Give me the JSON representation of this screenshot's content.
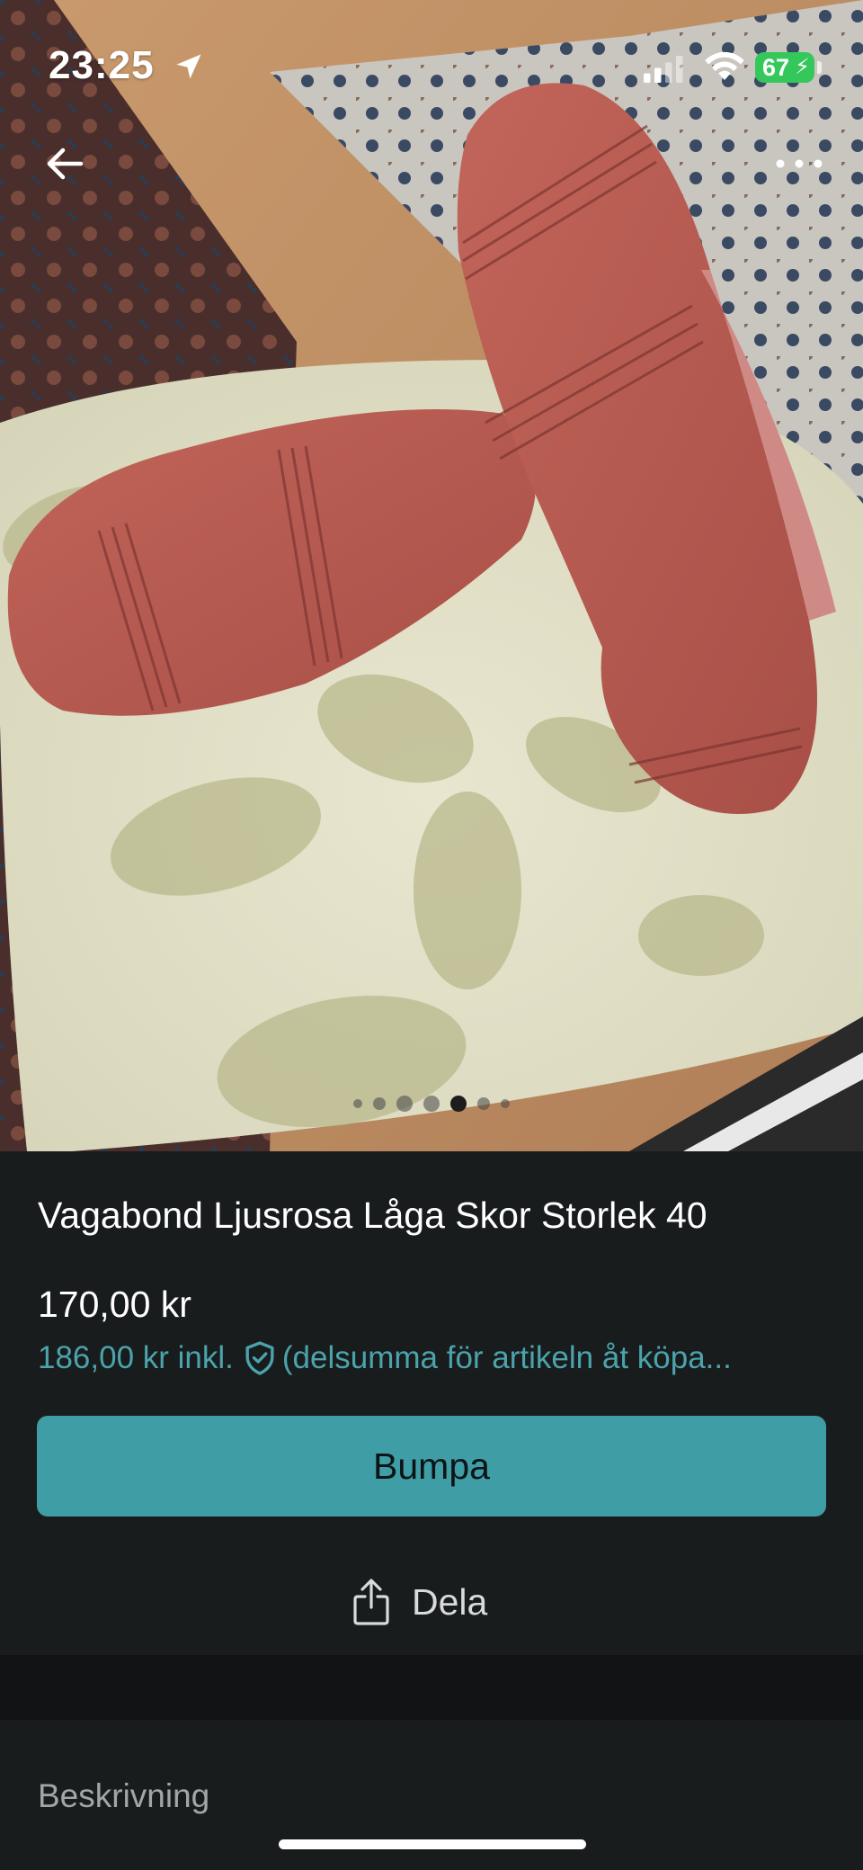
{
  "status_bar": {
    "time": "23:25",
    "battery_level": "67"
  },
  "icons": {
    "location": "location-arrow-icon",
    "signal": "cellular-signal-icon",
    "wifi": "wifi-icon",
    "battery": "battery-charging-icon",
    "back": "arrow-left-icon",
    "more": "more-horizontal-icon",
    "buyer_protection": "shield-check-icon",
    "share": "share-icon"
  },
  "photo": {
    "image_count": 7,
    "active_index": 4
  },
  "item": {
    "title": "Vagabond Ljusrosa Låga Skor Storlek 40",
    "price": "170,00 kr",
    "price_incl": "186,00 kr inkl.",
    "price_incl_note": "(delsumma för artikeln åt köpa..."
  },
  "actions": {
    "bump_label": "Bumpa",
    "share_label": "Dela"
  },
  "description": {
    "heading": "Beskrivning"
  },
  "colors": {
    "background": "#191c1d",
    "accent": "#3f9da5",
    "accent_text": "#4ba3ac",
    "battery": "#34c759"
  }
}
